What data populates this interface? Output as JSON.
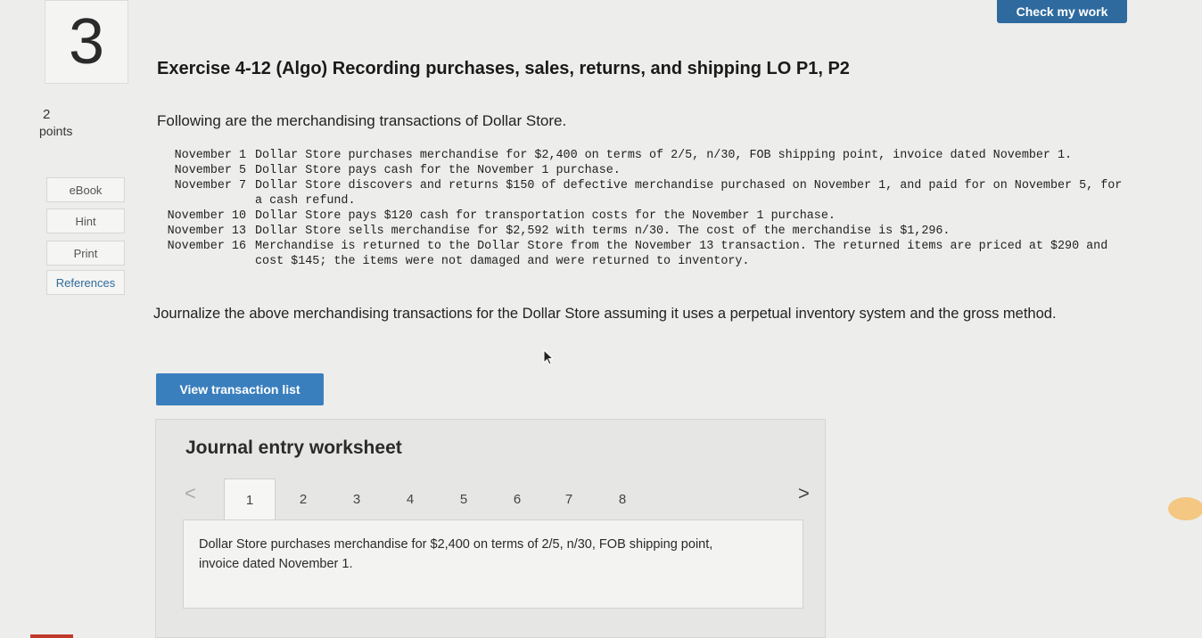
{
  "sidebar": {
    "question_number": "3",
    "points_value": "2",
    "points_label": "points",
    "tools": [
      "eBook",
      "Hint",
      "Print",
      "References"
    ]
  },
  "header": {
    "check_button": "Check my work"
  },
  "exercise": {
    "title": "Exercise 4-12 (Algo) Recording purchases, sales, returns, and shipping LO P1, P2",
    "intro": "Following are the merchandising transactions of Dollar Store.",
    "transactions": [
      {
        "date": "November 1",
        "text": "Dollar Store purchases merchandise for $2,400 on terms of 2/5, n/30, FOB shipping point, invoice dated November 1."
      },
      {
        "date": "November 5",
        "text": "Dollar Store pays cash for the November 1 purchase."
      },
      {
        "date": "November 7",
        "text": "Dollar Store discovers and returns $150 of defective merchandise purchased on November 1, and paid for on November 5, for a cash refund."
      },
      {
        "date": "November 10",
        "text": "Dollar Store pays $120 cash for transportation costs for the November 1 purchase."
      },
      {
        "date": "November 13",
        "text": "Dollar Store sells merchandise for $2,592 with terms n/30. The cost of the merchandise is $1,296."
      },
      {
        "date": "November 16",
        "text": "Merchandise is returned to the Dollar Store from the November 13 transaction. The returned items are priced at $290 and cost $145; the items were not damaged and were returned to inventory."
      }
    ],
    "instruction": "Journalize the above merchandising transactions for the Dollar Store assuming it uses a perpetual inventory system and the gross method.",
    "view_button": "View transaction list"
  },
  "worksheet": {
    "title": "Journal entry worksheet",
    "prev_arrow": "<",
    "next_arrow": ">",
    "tabs": [
      "1",
      "2",
      "3",
      "4",
      "5",
      "6",
      "7",
      "8"
    ],
    "active_tab": "1",
    "description": "Dollar Store purchases merchandise for $2,400 on terms of 2/5, n/30, FOB shipping point, invoice dated November 1."
  }
}
